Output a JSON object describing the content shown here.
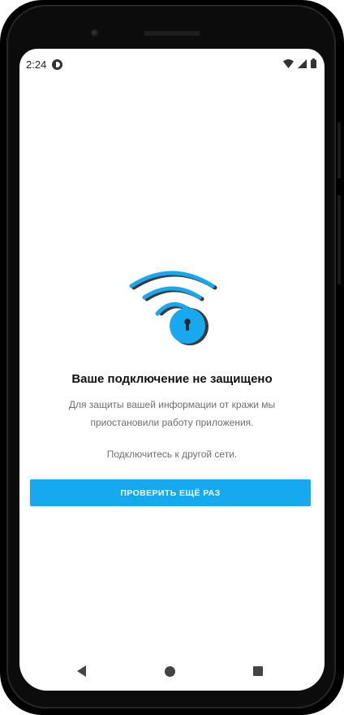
{
  "status_bar": {
    "time": "2:24",
    "app_icon": "app-notification-icon",
    "wifi_icon": "wifi-icon",
    "signal_icon": "cellular-signal-icon",
    "battery_icon": "battery-icon"
  },
  "illustration": {
    "icon": "wifi-padlock-icon",
    "accent_color": "#17a9ef",
    "shadow_color": "#3a3a3a"
  },
  "main": {
    "title": "Ваше подключение не защищено",
    "description": "Для защиты вашей информации от кражи мы приостановили работу приложения.",
    "hint": "Подключитесь к другой сети.",
    "retry_button_label": "ПРОВЕРИТЬ ЕЩЁ РАЗ"
  },
  "nav_bar": {
    "back_icon": "back-triangle-icon",
    "home_icon": "home-circle-icon",
    "recents_icon": "recents-square-icon"
  },
  "colors": {
    "button_background": "#17a9ef",
    "button_text": "#ffffff",
    "title_text": "#111111",
    "body_text": "#6f6f6f"
  }
}
